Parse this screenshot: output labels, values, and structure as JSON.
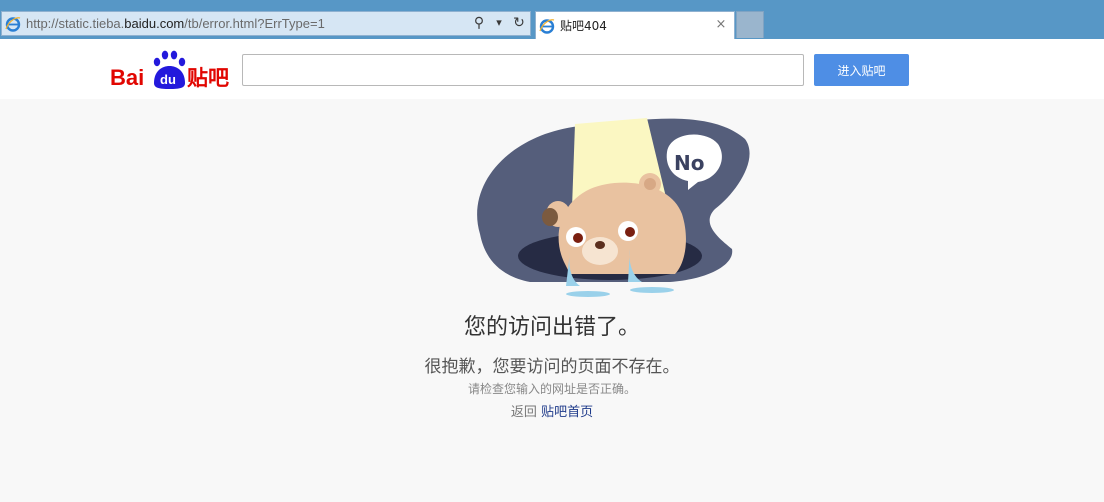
{
  "browser": {
    "url_prefix": "http://static.tieba.",
    "url_domain": "baidu.com",
    "url_suffix": "/tb/error.html?ErrType=1",
    "search_glyph": "⚲",
    "dropdown_glyph": "▾",
    "refresh_glyph": "↻",
    "tab_title": "贴吧404",
    "tab_close_glyph": "×",
    "icon": "ie-icon"
  },
  "header": {
    "logo_text_bai": "Bai",
    "logo_text_du": "du",
    "logo_text_tieba": "贴吧",
    "search_value": "",
    "enter_button_label": "进入贴吧",
    "colors": {
      "brand_red": "#e10601",
      "brand_blue": "#2319dc",
      "button_blue": "#4e8ee5"
    }
  },
  "error": {
    "illustration_text": "No",
    "headline": "您的访问出错了。",
    "subheadline": "很抱歉，您要访问的页面不存在。",
    "hint": "请检查您输入的网址是否正确。",
    "back_prefix": "返回",
    "back_link_label": "贴吧首页"
  }
}
